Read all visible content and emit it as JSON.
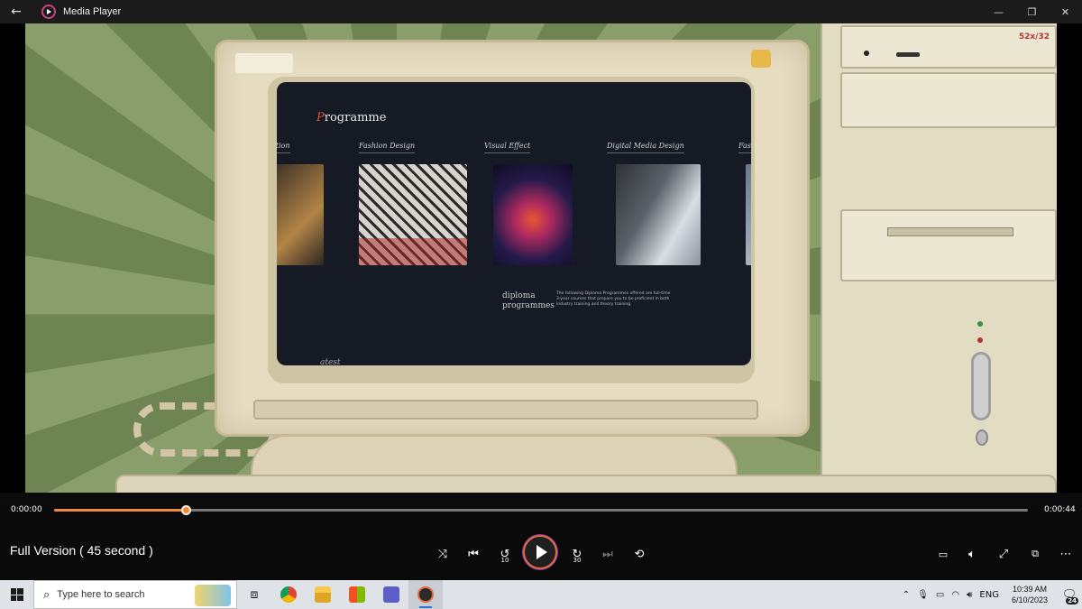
{
  "window": {
    "title": "Media Player",
    "back_icon": "back-arrow-icon",
    "minimize": "—",
    "maximize": "❐",
    "close": "✕"
  },
  "video": {
    "screen": {
      "heading_prefix": "P",
      "heading_rest": "rogramme",
      "cards": [
        {
          "label": "ation",
          "colors": [
            "#3a2f25",
            "#b28446"
          ]
        },
        {
          "label": "Fashion Design",
          "colors": [
            "#c9c4c0",
            "#7a2a2a"
          ]
        },
        {
          "label": "Visual Effect",
          "colors": [
            "#241a4a",
            "#e8562f"
          ]
        },
        {
          "label": "Digital Media Design",
          "colors": [
            "#5c6068",
            "#d9dee4"
          ]
        },
        {
          "label": "Fas",
          "colors": [
            "#6a7a86",
            "#a8b4be"
          ]
        }
      ],
      "diploma_line1": "diploma",
      "diploma_line2": "programmes",
      "diploma_text": "The following Diploma Programmes offered are full-time 3-year courses that prepare you to be proficient in both industry training and theory training.",
      "latest": "atest",
      "bay_label": "52x/32"
    }
  },
  "player": {
    "current_time": "0:00:00",
    "total_time": "0:00:44",
    "progress": 0.135,
    "title": "Full Version ( 45 second )",
    "skip_back_seconds": "10",
    "skip_forward_seconds": "30",
    "accent": "#f0883e"
  },
  "taskbar": {
    "search_placeholder": "Type here to search",
    "language": "ENG",
    "time": "10:39 AM",
    "date": "6/10/2023",
    "notification_count": "24"
  }
}
